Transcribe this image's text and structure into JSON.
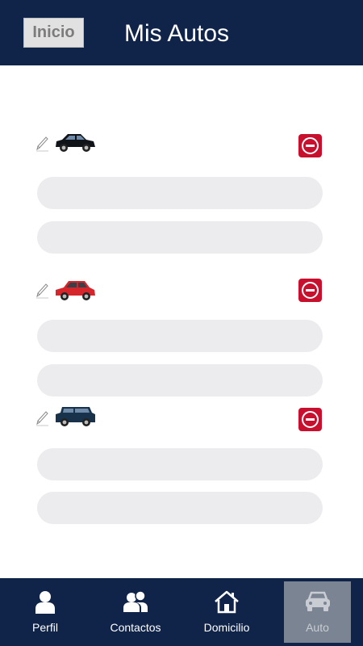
{
  "header": {
    "home_label": "Inicio",
    "title": "Mis Autos"
  },
  "cars": [
    {
      "icon": "black-sedan-car-icon",
      "color": "#101418",
      "field1_value": "",
      "field2_value": ""
    },
    {
      "icon": "red-hatchback-car-icon",
      "color": "#d6262b",
      "field1_value": "",
      "field2_value": ""
    },
    {
      "icon": "dark-blue-suv-car-icon",
      "color": "#17324a",
      "field1_value": "",
      "field2_value": ""
    }
  ],
  "tabs": [
    {
      "label": "Perfil",
      "icon": "person-icon",
      "active": false
    },
    {
      "label": "Contactos",
      "icon": "contacts-icon",
      "active": false
    },
    {
      "label": "Domicilio",
      "icon": "house-icon",
      "active": false
    },
    {
      "label": "Auto",
      "icon": "car-icon",
      "active": true
    }
  ],
  "colors": {
    "header_bg": "#10244a",
    "remove_button": "#c8102e",
    "field_bg": "#ececee",
    "active_tab_bg": "#7b8493"
  }
}
